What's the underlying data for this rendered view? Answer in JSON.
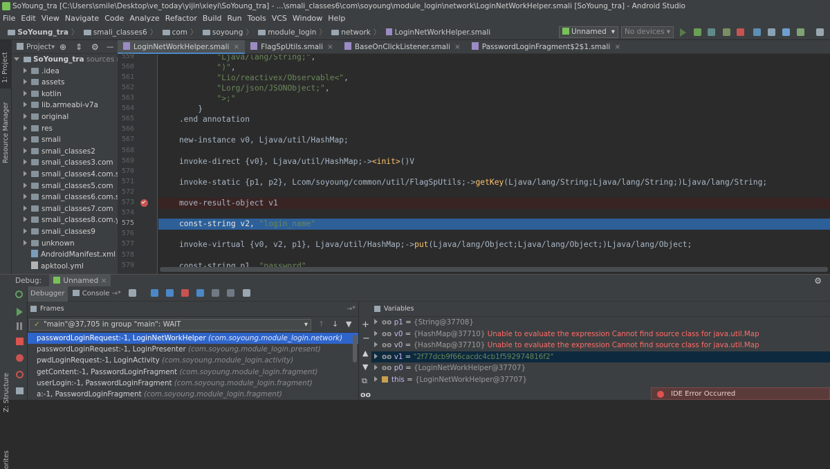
{
  "window": {
    "title": "SoYoung_tra [C:\\Users\\smile\\Desktop\\ve_today\\yijin\\xieyi\\SoYoung_tra] - ...\\smali_classes6\\com\\soyoung\\module_login\\network\\LoginNetWorkHelper.smali [SoYoung_tra] - Android Studio"
  },
  "menu": [
    "File",
    "Edit",
    "View",
    "Navigate",
    "Code",
    "Analyze",
    "Refactor",
    "Build",
    "Run",
    "Tools",
    "VCS",
    "Window",
    "Help"
  ],
  "breadcrumb": [
    "SoYoung_tra",
    "smali_classes6",
    "com",
    "soyoung",
    "module_login",
    "network",
    "LoginNetWorkHelper.smali"
  ],
  "toolbar": {
    "run_config": "Unnamed",
    "devices": "No devices"
  },
  "project": {
    "header": "Project",
    "root": "SoYoung_tra",
    "root_suffix": "sources roo",
    "items": [
      ".idea",
      "assets",
      "kotlin",
      "lib.armeabi-v7a",
      "original",
      "res",
      "smali",
      "smali_classes2",
      "smali_classes3.com",
      "smali_classes4.com.soy",
      "smali_classes5.com",
      "smali_classes6.com.soy",
      "smali_classes7.com",
      "smali_classes8.com.you",
      "smali_classes9",
      "unknown",
      "AndroidManifest.xml",
      "apktool.yml"
    ]
  },
  "left_tools": {
    "project": "1: Project",
    "resource_manager": "Resource Manager",
    "structure": "Z: Structure",
    "favorites": "orites"
  },
  "tabs": [
    "LoginNetWorkHelper.smali",
    "FlagSpUtils.smali",
    "BaseOnClickListener.smali",
    "PasswordLoginFragment$2$1.smali"
  ],
  "editor": {
    "lines": [
      {
        "n": "559",
        "text": "        \"Ljava/lang/String;\","
      },
      {
        "n": "560",
        "text": "        \")\","
      },
      {
        "n": "561",
        "text": "        \"Lio/reactivex/Observable<\","
      },
      {
        "n": "562",
        "text": "        \"Lorg/json/JSONObject;\","
      },
      {
        "n": "563",
        "text": "        \">;\""
      },
      {
        "n": "564",
        "text": "    }"
      },
      {
        "n": "565",
        "text": ".end annotation"
      },
      {
        "n": "566",
        "text": ""
      },
      {
        "n": "567",
        "text": "new-instance v0, Ljava/util/HashMap;"
      },
      {
        "n": "568",
        "text": ""
      },
      {
        "n": "569",
        "text": "invoke-direct {v0}, Ljava/util/HashMap;-><init>()V"
      },
      {
        "n": "570",
        "text": ""
      },
      {
        "n": "571",
        "text": "invoke-static {p1, p2}, Lcom/soyoung/common/util/FlagSpUtils;->getKey(Ljava/lang/String;Ljava/lang/String;)Ljava/lang/String;"
      },
      {
        "n": "572",
        "text": ""
      },
      {
        "n": "573",
        "text": "move-result-object v1"
      },
      {
        "n": "574",
        "text": ""
      },
      {
        "n": "575",
        "text": "const-string v2, \"login_name\""
      },
      {
        "n": "576",
        "text": ""
      },
      {
        "n": "577",
        "text": "invoke-virtual {v0, v2, p1}, Ljava/util/HashMap;->put(Ljava/lang/Object;Ljava/lang/Object;)Ljava/lang/Object;"
      },
      {
        "n": "578",
        "text": ""
      },
      {
        "n": "579",
        "text": "const-string p1, \"password\""
      }
    ],
    "breakpoint_line": "573",
    "current_line": "575"
  },
  "debug": {
    "label": "Debug:",
    "session": "Unnamed",
    "tab_debugger": "Debugger",
    "tab_console": "Console",
    "frames_title": "Frames",
    "variables_title": "Variables",
    "thread": "\"main\"@37,705 in group \"main\": WAIT",
    "frames": [
      {
        "m": "passwordLoginRequest:-1, LoginNetWorkHelper",
        "p": "(com.soyoung.module_login.network)"
      },
      {
        "m": "passwordLoginRequest:-1, LoginPresenter",
        "p": "(com.soyoung.module_login.present)"
      },
      {
        "m": "pwdLoginRequest:-1, LoginActivity",
        "p": "(com.soyoung.module_login.activity)"
      },
      {
        "m": "getContent:-1, PasswordLoginFragment",
        "p": "(com.soyoung.module_login.fragment)"
      },
      {
        "m": "userLogin:-1, PasswordLoginFragment",
        "p": "(com.soyoung.module_login.fragment)"
      },
      {
        "m": "a:-1, PasswordLoginFragment",
        "p": "(com.soyoung.module_login.fragment)"
      }
    ],
    "variables": [
      {
        "name": "p1",
        "val": "{String@37708}",
        "err": ""
      },
      {
        "name": "v0",
        "val": "{HashMap@37710}",
        "err": "Unable to evaluate the expression Cannot find source class for java.util.Map"
      },
      {
        "name": "v0",
        "val": "{HashMap@37710}",
        "err": "Unable to evaluate the expression Cannot find source class for java.util.Map"
      },
      {
        "name": "v1",
        "val": "\"2f77dcb9f66cacdc4cb1f592974816f2\"",
        "err": ""
      },
      {
        "name": "p0",
        "val": "{LoginNetWorkHelper@37707}",
        "err": ""
      },
      {
        "name": "this",
        "val": "{LoginNetWorkHelper@37707}",
        "err": ""
      }
    ],
    "error_popup": "IDE Error Occurred"
  }
}
